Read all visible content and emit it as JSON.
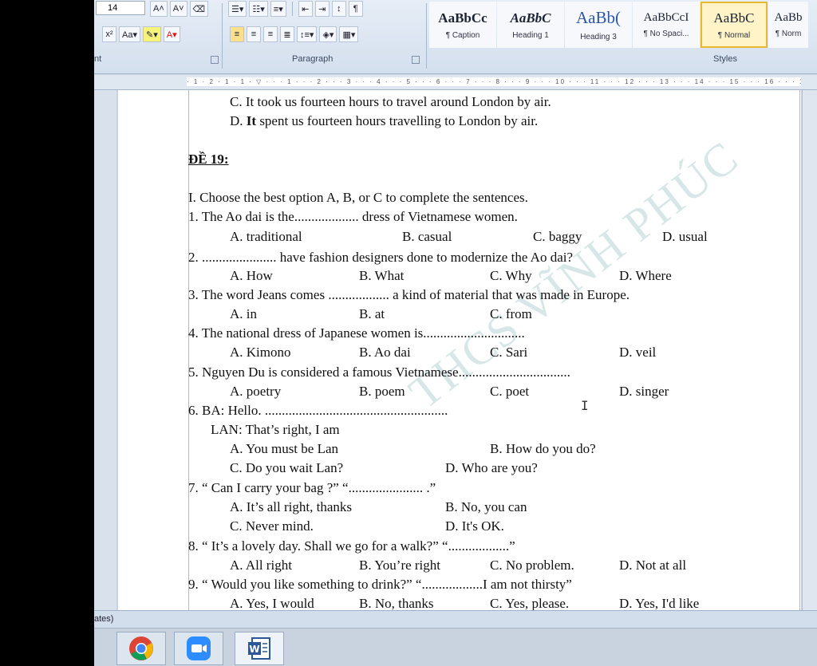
{
  "ribbon": {
    "font_size": "14",
    "groups": {
      "paragraph": "Paragraph",
      "styles": "Styles",
      "font_edge": "nt"
    },
    "styles": [
      {
        "sample": "AaBbCc",
        "name": "¶ Caption"
      },
      {
        "sample": "AaBbC",
        "name": "Heading 1"
      },
      {
        "sample": "AaBb(",
        "name": "Heading 3"
      },
      {
        "sample": "AaBbCcI",
        "name": "¶ No Spaci..."
      },
      {
        "sample": "AaBbC",
        "name": "¶ Normal"
      },
      {
        "sample": "AaBb",
        "name": "¶ Norm"
      }
    ],
    "accent_color": "#e8b92e"
  },
  "document": {
    "lines": {
      "c_prev": "C. It took us fourteen hours to travel around London by air.",
      "d_prev_a": "D. ",
      "d_prev_b": "It",
      "d_prev_c": " spent us fourteen hours travelling to London by air.",
      "heading": "ĐỀ 19:",
      "section": "I. Choose the best option A, B, or C to complete the sentences.",
      "q1": "1. The Ao dai is the................... dress of Vietnamese women.",
      "q2": "2. ...................... have fashion designers done to modernize the Ao dai?",
      "q3": "3. The word Jeans comes .................. a kind of material that was made in Europe.",
      "q4": "4. The national dress of Japanese women is..............................",
      "q5": "5. Nguyen Du is considered a famous Vietnamese.................................",
      "q6": "6.   BA: Hello. ......................................................",
      "q6b": "LAN: That’s right, I am",
      "q7": "7. “ Can I carry your bag  ?” “...................... .”",
      "q8": "8. “ It’s a lovely day. Shall we go for a walk?” “..................”",
      "q9": "9. “ Would you like something to drink?” “..................I am not thirsty”"
    },
    "options": {
      "q1": [
        "A. traditional",
        "B. casual",
        "C. baggy",
        "D. usual"
      ],
      "q2": [
        "A. How",
        "B. What",
        "C. Why",
        "D. Where"
      ],
      "q3": [
        "A. in",
        "B. at",
        "C. from"
      ],
      "q4": [
        "A. Kimono",
        "B. Ao dai",
        "C. Sari",
        "D. veil"
      ],
      "q5": [
        "A. poetry",
        "B. poem",
        "C. poet",
        "D. singer"
      ],
      "q6": [
        "A. You must be Lan",
        "B. How do you do?",
        "C. Do you wait Lan?",
        "D. Who are you?"
      ],
      "q7": [
        "A. It’s all right, thanks",
        "B. No, you can",
        "C. Never mind.",
        "D. It's OK."
      ],
      "q8": [
        "A. All right",
        "B. You’re right",
        "C. No problem.",
        "D. Not at all"
      ],
      "q9": [
        "A. Yes, I would",
        "B. No, thanks",
        "C. Yes, please.",
        "D. Yes, I'd like"
      ]
    },
    "watermark": "THCS VĨNH PHÚC"
  },
  "status": {
    "text": "ates)"
  },
  "taskbar": [
    "chrome-icon",
    "zoom-icon",
    "word-icon"
  ]
}
